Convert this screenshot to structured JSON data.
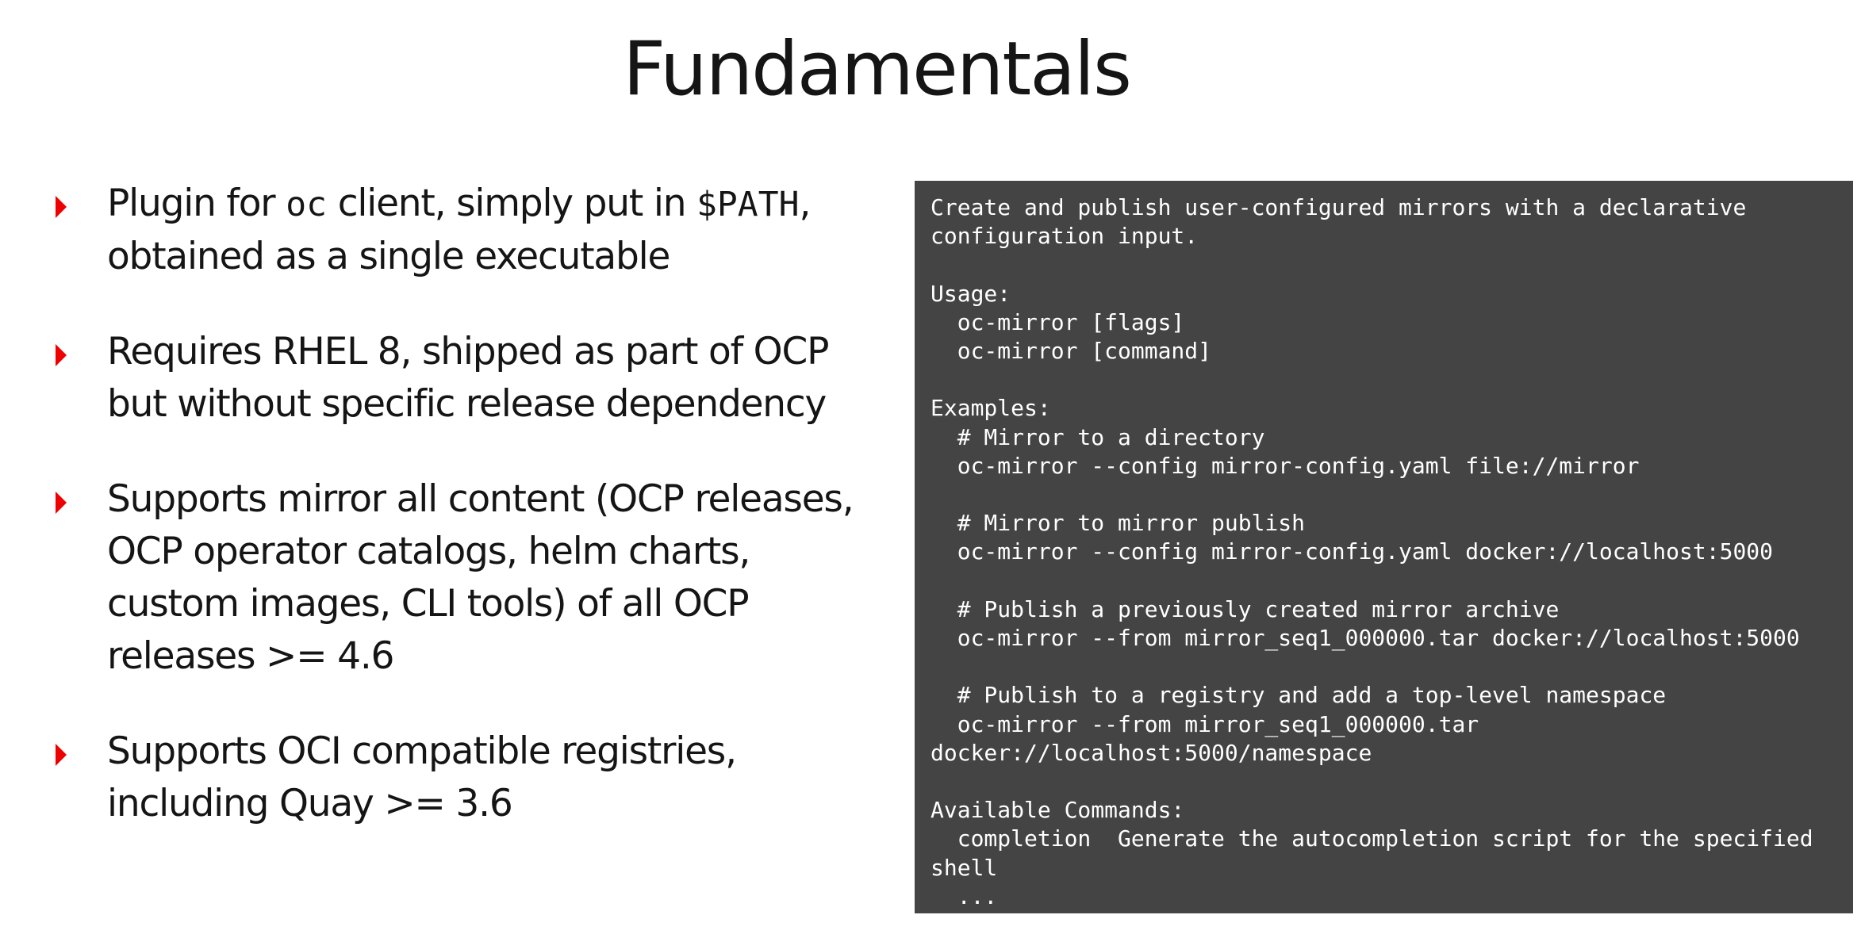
{
  "slide": {
    "title": "Fundamentals",
    "bullets": {
      "b1": {
        "t1": "Plugin for ",
        "code1": "oc",
        "t2": " client, simply put in ",
        "code2": "$PATH",
        "t3": ", obtained as a single executable"
      },
      "b2": "Requires RHEL 8, shipped as part of OCP but without specific release dependency",
      "b3": "Supports mirror all content (OCP releases, OCP operator catalogs, helm charts, custom images, CLI tools) of all OCP releases >= 4.6",
      "b4": "Supports OCI compatible registries, including Quay >= 3.6"
    },
    "terminal": {
      "text": "Create and publish user-configured mirrors with a declarative\nconfiguration input.\n\nUsage:\n  oc-mirror [flags]\n  oc-mirror [command]\n\nExamples:\n  # Mirror to a directory\n  oc-mirror --config mirror-config.yaml file://mirror\n\n  # Mirror to mirror publish\n  oc-mirror --config mirror-config.yaml docker://localhost:5000\n\n  # Publish a previously created mirror archive\n  oc-mirror --from mirror_seq1_000000.tar docker://localhost:5000\n\n  # Publish to a registry and add a top-level namespace\n  oc-mirror --from mirror_seq1_000000.tar\ndocker://localhost:5000/namespace\n\nAvailable Commands:\n  completion  Generate the autocompletion script for the specified\nshell\n  ..."
    },
    "colors": {
      "bullet_accent": "#ee0000",
      "terminal_background": "#444444",
      "terminal_text": "#ffffff",
      "body_text": "#151515"
    },
    "icons": {
      "bullet": "caret-right-icon"
    }
  }
}
